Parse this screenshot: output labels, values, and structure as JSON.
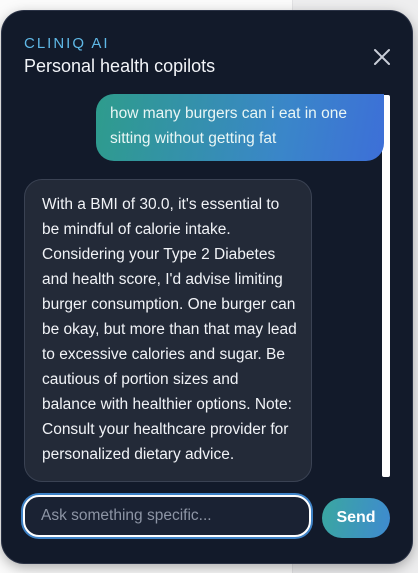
{
  "header": {
    "brand": "CLINIQ AI",
    "subtitle": "Personal health copilots"
  },
  "icons": {
    "close": "close-icon"
  },
  "messages": [
    {
      "role": "user",
      "text": "how many burgers can i eat in one sitting without getting fat"
    },
    {
      "role": "assistant",
      "text": "With a BMI of 30.0, it's essential to be mindful of calorie intake. Considering your Type 2 Diabetes and health score, I'd advise limiting burger consumption. One burger can be okay, but more than that may lead to excessive calories and sugar. Be cautious of portion sizes and balance with healthier options. Note: Consult your healthcare provider for personalized dietary advice."
    }
  ],
  "composer": {
    "placeholder": "Ask something specific...",
    "value": "",
    "send_label": "Send"
  },
  "colors": {
    "panel_bg": "#121a2a",
    "brand_accent": "#5fb8e6",
    "user_bubble_start": "#2e9c8c",
    "user_bubble_end": "#3d6fd8",
    "bot_bubble_bg": "#232a38",
    "input_focus_ring": "#3e82c6"
  }
}
